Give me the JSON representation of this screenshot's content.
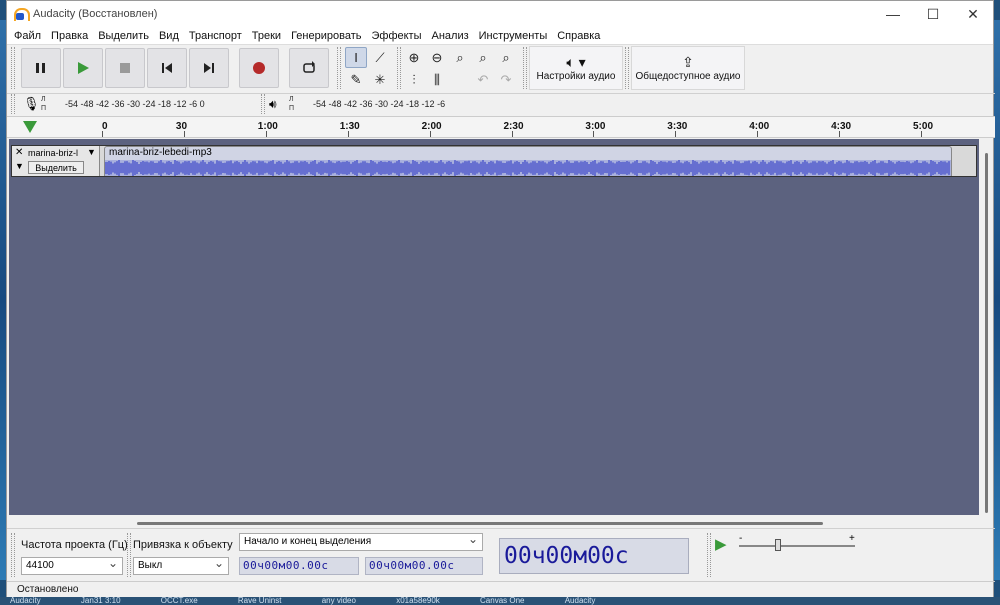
{
  "window": {
    "title": "Audacity (Восстановлен)",
    "minimize": "—",
    "maximize": "☐",
    "close": "✕"
  },
  "menu": [
    "Файл",
    "Правка",
    "Выделить",
    "Вид",
    "Транспорт",
    "Треки",
    "Генерировать",
    "Эффекты",
    "Анализ",
    "Инструменты",
    "Справка"
  ],
  "toolbar": {
    "audio_setup_label": "Настройки аудио",
    "share_audio_label": "Общедоступное аудио",
    "record_color": "#b52a2a",
    "play_color": "#3a9a3a"
  },
  "meters": {
    "record_scale": "-54  -48  -42  -36  -30  -24  -18  -12   -6    0",
    "play_scale": "-54  -48  -42  -36  -30  -24  -18  -12   -6",
    "lp_l": "Л",
    "lp_r": "П"
  },
  "ruler": {
    "ticks": [
      "0",
      "30",
      "1:00",
      "1:30",
      "2:00",
      "2:30",
      "3:00",
      "3:30",
      "4:00",
      "4:30",
      "5:00"
    ]
  },
  "track": {
    "name": "marina-briz-l",
    "select_label": "Выделить",
    "clip_name": "marina-briz-lebedi-mp3",
    "wave_color": "#3a44c8"
  },
  "selection": {
    "rate_label": "Частота проекта (Гц)",
    "rate_value": "44100",
    "snap_label": "Привязка к объекту",
    "snap_value": "Выкл",
    "range_mode": "Начало и конец выделения",
    "start_time": "00ч00м00.00с",
    "end_time": "00ч00м00.00с",
    "big_time": "00ч00м00с",
    "speed_minus": "-",
    "speed_plus": "+"
  },
  "status": {
    "text": "Остановлено"
  },
  "taskbar": [
    "Audacity",
    "Jan31 3:10",
    "OCCT.exe",
    "Rave Uninst",
    "any video",
    "x01a58e90k",
    "Canvas One",
    "Audacity"
  ]
}
